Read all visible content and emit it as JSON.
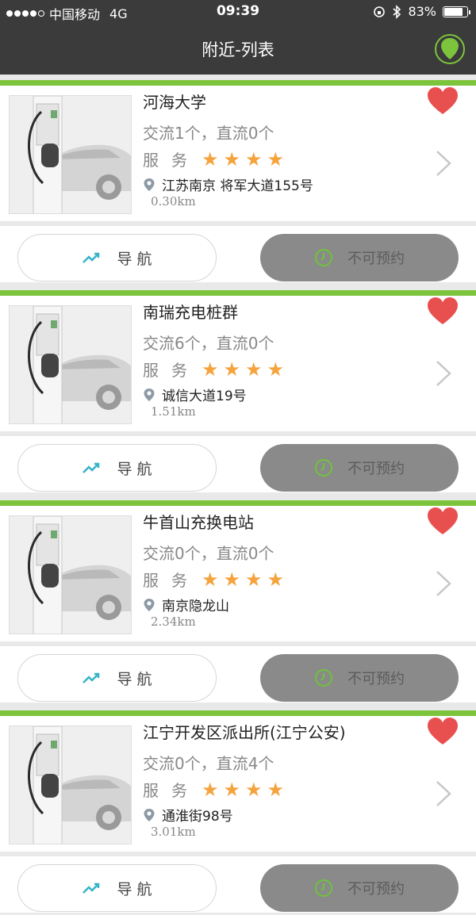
{
  "status": {
    "carrier": "中国移动",
    "network": "4G",
    "time": "09:39",
    "battery": "83%",
    "battery_level": 0.83
  },
  "header": {
    "title": "附近-列表",
    "map_icon": "map-pin-icon"
  },
  "common": {
    "nav_label": "导 航",
    "reserve_label": "不可预约",
    "service_label": "服务",
    "star_count": 4
  },
  "stations": [
    {
      "name": "河海大学",
      "ports": "交流1个，直流0个",
      "address": "江苏南京 将军大道155号",
      "distance": "0.30km"
    },
    {
      "name": "南瑞充电桩群",
      "ports": "交流6个，直流0个",
      "address": "诚信大道19号",
      "distance": "1.51km"
    },
    {
      "name": "牛首山充换电站",
      "ports": "交流0个，直流0个",
      "address": "南京隐龙山",
      "distance": "2.34km"
    },
    {
      "name": "江宁开发区派出所(江宁公安)",
      "ports": "交流0个，直流4个",
      "address": "通淮街98号",
      "distance": "3.01km"
    }
  ],
  "colors": {
    "accent": "#7cc43c",
    "heart": "#e8504f",
    "star": "#f5a33d",
    "header": "#3b3b3b"
  }
}
